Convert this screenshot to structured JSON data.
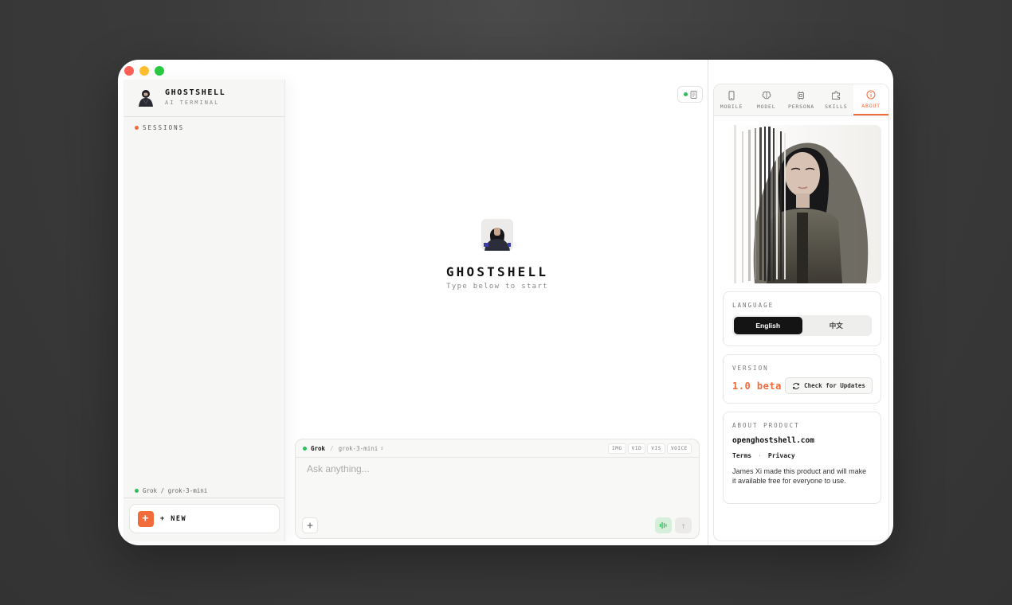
{
  "sidebar": {
    "brand_name": "GHOSTSHELL",
    "brand_sub": "AI TERMINAL",
    "sessions_label": "SESSIONS",
    "model_status": "Grok / grok-3-mini",
    "new_label": "+ NEW",
    "new_icon": "+"
  },
  "hero": {
    "title": "GHOSTSHELL",
    "subtitle": "Type below to start"
  },
  "composer": {
    "provider": "Grok",
    "separator": "/",
    "model": "grok-3-mini",
    "tags": [
      "IMG",
      "VID",
      "VIS",
      "VOICE"
    ],
    "placeholder": "Ask anything...",
    "attach_label": "+"
  },
  "panel": {
    "tabs": [
      {
        "label": "MOBILE",
        "icon": "mobile-icon"
      },
      {
        "label": "MODEL",
        "icon": "brain-icon"
      },
      {
        "label": "PERSONA",
        "icon": "chip-icon"
      },
      {
        "label": "SKILLS",
        "icon": "puzzle-icon"
      },
      {
        "label": "ABOUT",
        "icon": "info-icon"
      }
    ],
    "active_tab": "ABOUT",
    "language": {
      "label": "LANGUAGE",
      "options": [
        "English",
        "中文"
      ],
      "selected": "English"
    },
    "version": {
      "label": "VERSION",
      "value": "1.0 beta",
      "update_button": "Check for Updates"
    },
    "about": {
      "label": "ABOUT PRODUCT",
      "domain": "openghostshell.com",
      "terms": "Terms",
      "link_sep": "·",
      "privacy": "Privacy",
      "text": "James Xi made this product and will make it available free for everyone to use."
    }
  },
  "colors": {
    "accent": "#f26b3a",
    "online": "#2ebd5a",
    "dark": "#141414"
  }
}
